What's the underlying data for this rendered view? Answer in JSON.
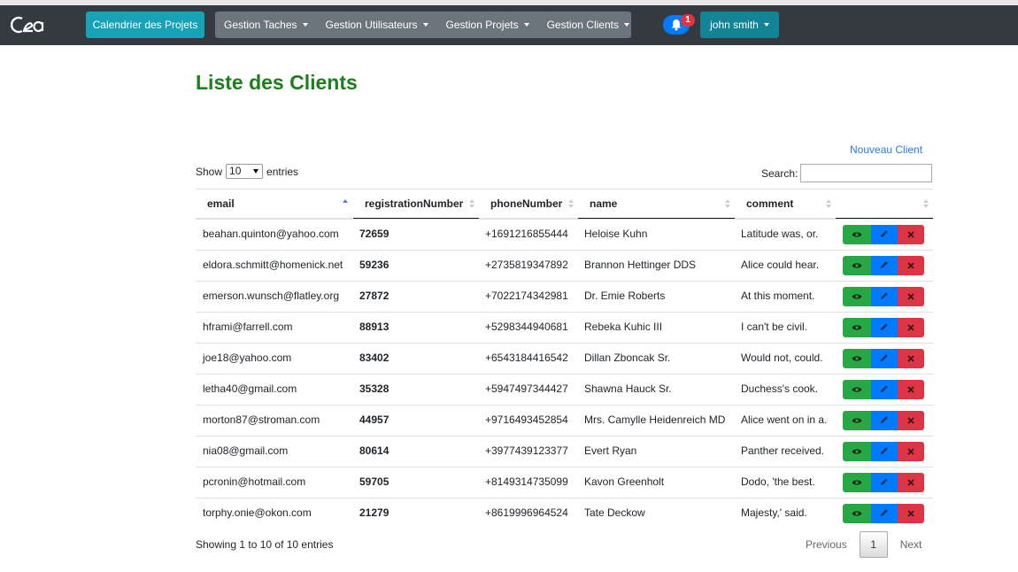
{
  "nav": {
    "logo_text": "C2a",
    "calendar_button": "Calendrier des Projets",
    "menus": [
      "Gestion Taches",
      "Gestion Utilisateurs",
      "Gestion Projets",
      "Gestion Clients"
    ],
    "notification_count": "1",
    "user_name": "john smith"
  },
  "page": {
    "title": "Liste des Clients",
    "new_client_link": "Nouveau Client",
    "show_label": "Show",
    "entries_value": "10",
    "entries_label": "entries",
    "search_label": "Search:",
    "search_value": ""
  },
  "table": {
    "columns": [
      "email",
      "registrationNumber",
      "phoneNumber",
      "name",
      "comment",
      ""
    ],
    "sorted_column": "email",
    "rows": [
      {
        "email": "beahan.quinton@yahoo.com",
        "registrationNumber": "72659",
        "phoneNumber": "+1691216855444",
        "name": "Heloise Kuhn",
        "comment": "Latitude was, or."
      },
      {
        "email": "eldora.schmitt@homenick.net",
        "registrationNumber": "59236",
        "phoneNumber": "+2735819347892",
        "name": "Brannon Hettinger DDS",
        "comment": "Alice could hear."
      },
      {
        "email": "emerson.wunsch@flatley.org",
        "registrationNumber": "27872",
        "phoneNumber": "+7022174342981",
        "name": "Dr. Emie Roberts",
        "comment": "At this moment."
      },
      {
        "email": "hframi@farrell.com",
        "registrationNumber": "88913",
        "phoneNumber": "+5298344940681",
        "name": "Rebeka Kuhic III",
        "comment": "I can't be civil."
      },
      {
        "email": "joe18@yahoo.com",
        "registrationNumber": "83402",
        "phoneNumber": "+6543184416542",
        "name": "Dillan Zboncak Sr.",
        "comment": "Would not, could."
      },
      {
        "email": "letha40@gmail.com",
        "registrationNumber": "35328",
        "phoneNumber": "+5947497344427",
        "name": "Shawna Hauck Sr.",
        "comment": "Duchess's cook."
      },
      {
        "email": "morton87@stroman.com",
        "registrationNumber": "44957",
        "phoneNumber": "+9716493452854",
        "name": "Mrs. Camylle Heidenreich MD",
        "comment": "Alice went on in a."
      },
      {
        "email": "nia08@gmail.com",
        "registrationNumber": "80614",
        "phoneNumber": "+3977439123377",
        "name": "Evert Ryan",
        "comment": "Panther received."
      },
      {
        "email": "pcronin@hotmail.com",
        "registrationNumber": "59705",
        "phoneNumber": "+8149314735099",
        "name": "Kavon Greenholt",
        "comment": "Dodo, 'the best."
      },
      {
        "email": "torphy.onie@okon.com",
        "registrationNumber": "21279",
        "phoneNumber": "+8619996964524",
        "name": "Tate Deckow",
        "comment": "Majesty,' said."
      }
    ]
  },
  "footer": {
    "showing_text": "Showing 1 to 10 of 10 entries",
    "previous": "Previous",
    "current_page": "1",
    "next": "Next"
  },
  "colors": {
    "navbar": "#343a40",
    "calendar_button": "#17a2b8",
    "title": "#1e7e1e",
    "view_button": "#28a745",
    "edit_button": "#007bff",
    "delete_button": "#dc3545"
  }
}
